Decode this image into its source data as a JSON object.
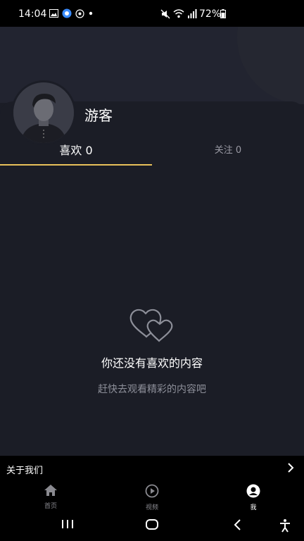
{
  "status_bar": {
    "time": "14:04",
    "battery": "72%"
  },
  "profile": {
    "username": "游客"
  },
  "tabs": [
    {
      "label": "喜欢 0"
    },
    {
      "label": "关注 0"
    }
  ],
  "empty_state": {
    "title": "你还没有喜欢的内容",
    "subtitle": "赶快去观看精彩的内容吧"
  },
  "about": {
    "label": "关于我们"
  },
  "bottom_nav": [
    {
      "label": "首页",
      "icon": "home-icon"
    },
    {
      "label": "视频",
      "icon": "play-circle-icon"
    },
    {
      "label": "我",
      "icon": "user-icon"
    }
  ],
  "colors": {
    "accent": "#e8c15a",
    "background": "#1b1d26"
  }
}
